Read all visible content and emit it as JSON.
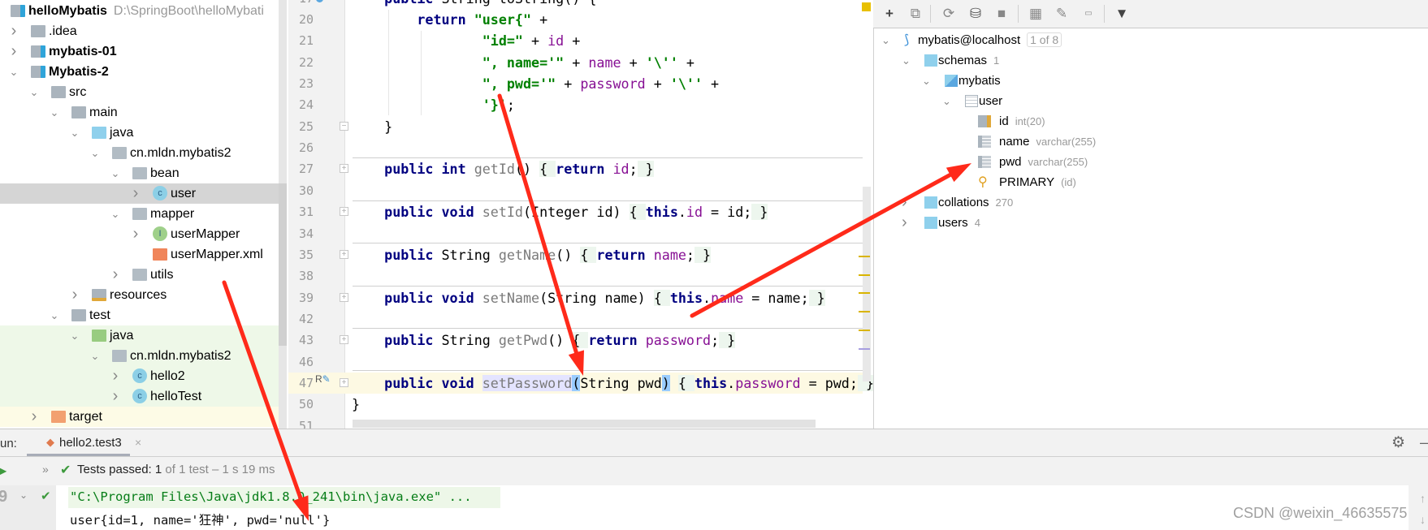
{
  "project_tree": {
    "rows": [
      {
        "label": "helloMybatis",
        "hint": "D:\\SpringBoot\\helloMybati",
        "level": -1,
        "chevron": "none",
        "icon": "module-folder",
        "bold": true
      },
      {
        "label": ".idea",
        "level": 0,
        "chevron": "right",
        "icon": "folder"
      },
      {
        "label": "mybatis-01",
        "level": 0,
        "chevron": "right",
        "icon": "module-folder",
        "bold": true
      },
      {
        "label": "Mybatis-2",
        "level": 0,
        "chevron": "down",
        "icon": "module-folder",
        "bold": true
      },
      {
        "label": "src",
        "level": 1,
        "chevron": "down",
        "icon": "folder"
      },
      {
        "label": "main",
        "level": 2,
        "chevron": "down",
        "icon": "folder"
      },
      {
        "label": "java",
        "level": 3,
        "chevron": "down",
        "icon": "source-folder"
      },
      {
        "label": "cn.mldn.mybatis2",
        "level": 4,
        "chevron": "down",
        "icon": "package"
      },
      {
        "label": "bean",
        "level": 5,
        "chevron": "down",
        "icon": "package"
      },
      {
        "label": "user",
        "level": 6,
        "chevron": "right",
        "icon": "class",
        "selected": true
      },
      {
        "label": "mapper",
        "level": 5,
        "chevron": "down",
        "icon": "package"
      },
      {
        "label": "userMapper",
        "level": 6,
        "chevron": "right",
        "icon": "interface"
      },
      {
        "label": "userMapper.xml",
        "level": 6,
        "chevron": "none",
        "icon": "xml-file"
      },
      {
        "label": "utils",
        "level": 5,
        "chevron": "right",
        "icon": "package"
      },
      {
        "label": "resources",
        "level": 3,
        "chevron": "right",
        "icon": "resources-folder"
      },
      {
        "label": "test",
        "level": 2,
        "chevron": "down",
        "icon": "folder"
      },
      {
        "label": "java",
        "level": 3,
        "chevron": "down",
        "icon": "test-source-folder",
        "tint": "green"
      },
      {
        "label": "cn.mldn.mybatis2",
        "level": 4,
        "chevron": "down",
        "icon": "package",
        "tint": "green"
      },
      {
        "label": "hello2",
        "level": 5,
        "chevron": "right",
        "icon": "test-class",
        "tint": "green"
      },
      {
        "label": "helloTest",
        "level": 5,
        "chevron": "right",
        "icon": "test-class",
        "tint": "green"
      },
      {
        "label": "target",
        "level": 1,
        "chevron": "right",
        "icon": "excluded-folder",
        "tint": "yellow"
      }
    ]
  },
  "editor": {
    "lines": [
      {
        "num": "17",
        "tokens": [
          [
            "kw",
            "    public "
          ],
          [
            "",
            "String toString() {"
          ]
        ]
      },
      {
        "num": "20",
        "tokens": [
          [
            "kw",
            "        return "
          ],
          [
            "str",
            "\"user{\""
          ],
          [
            "",
            " +"
          ]
        ]
      },
      {
        "num": "21",
        "tokens": [
          [
            "str",
            "                \"id=\""
          ],
          [
            "",
            " + "
          ],
          [
            "fld",
            "id"
          ],
          [
            "",
            " +"
          ]
        ]
      },
      {
        "num": "22",
        "tokens": [
          [
            "str",
            "                \", name='\""
          ],
          [
            "",
            " + "
          ],
          [
            "fld",
            "name"
          ],
          [
            "",
            " + "
          ],
          [
            "str",
            "'\\''"
          ],
          [
            "",
            " +"
          ]
        ]
      },
      {
        "num": "23",
        "tokens": [
          [
            "str",
            "                \", pwd='\""
          ],
          [
            "",
            " + "
          ],
          [
            "fld",
            "password"
          ],
          [
            "",
            " + "
          ],
          [
            "str",
            "'\\''"
          ],
          [
            "",
            " +"
          ]
        ]
      },
      {
        "num": "24",
        "tokens": [
          [
            "str",
            "                '}'"
          ],
          [
            "",
            ";"
          ]
        ]
      },
      {
        "num": "25",
        "tokens": [
          [
            "",
            "    }"
          ]
        ]
      },
      {
        "num": "26",
        "tokens": []
      },
      {
        "num": "27",
        "tokens": [
          [
            "kw",
            "    public int "
          ],
          [
            "meth",
            "getId"
          ],
          [
            "",
            "()"
          ],
          [
            "",
            " "
          ],
          [
            "fb",
            "{ "
          ],
          [
            "kw",
            "return "
          ],
          [
            "fld",
            "id"
          ],
          [
            "",
            ";"
          ],
          [
            "fb",
            " }"
          ]
        ]
      },
      {
        "num": "30",
        "tokens": []
      },
      {
        "num": "31",
        "tokens": [
          [
            "kw",
            "    public void "
          ],
          [
            "meth",
            "setId"
          ],
          [
            "",
            "(Integer id) "
          ],
          [
            "fb",
            "{ "
          ],
          [
            "kw",
            "this"
          ],
          [
            "",
            "."
          ],
          [
            "fld",
            "id"
          ],
          [
            "",
            " = id;"
          ],
          [
            "fb",
            " }"
          ]
        ]
      },
      {
        "num": "34",
        "tokens": []
      },
      {
        "num": "35",
        "tokens": [
          [
            "kw",
            "    public "
          ],
          [
            "",
            "String "
          ],
          [
            "meth",
            "getName"
          ],
          [
            "",
            "() "
          ],
          [
            "fb",
            "{ "
          ],
          [
            "kw",
            "return "
          ],
          [
            "fld",
            "name"
          ],
          [
            "",
            ";"
          ],
          [
            "fb",
            " }"
          ]
        ]
      },
      {
        "num": "38",
        "tokens": []
      },
      {
        "num": "39",
        "tokens": [
          [
            "kw",
            "    public void "
          ],
          [
            "meth",
            "setName"
          ],
          [
            "",
            "(String name) "
          ],
          [
            "fb",
            "{ "
          ],
          [
            "kw",
            "this"
          ],
          [
            "",
            "."
          ],
          [
            "fld",
            "name"
          ],
          [
            "",
            " = name;"
          ],
          [
            "fb",
            " }"
          ]
        ]
      },
      {
        "num": "42",
        "tokens": []
      },
      {
        "num": "43",
        "tokens": [
          [
            "kw",
            "    public "
          ],
          [
            "",
            "String "
          ],
          [
            "meth",
            "getPwd"
          ],
          [
            "",
            "() "
          ],
          [
            "fb",
            "{ "
          ],
          [
            "kw",
            "return "
          ],
          [
            "fld",
            "password"
          ],
          [
            "",
            ";"
          ],
          [
            "fb",
            " }"
          ]
        ]
      },
      {
        "num": "46",
        "tokens": []
      },
      {
        "num": "47",
        "tokens": [
          [
            "kw",
            "    public void "
          ],
          [
            "meth hl",
            "setPassword"
          ],
          [
            "par",
            "("
          ],
          [
            "",
            "String pwd"
          ],
          [
            "par",
            ")"
          ],
          [
            "",
            " "
          ],
          [
            "fb",
            "{ "
          ],
          [
            "kw",
            "this"
          ],
          [
            "",
            "."
          ],
          [
            "fld",
            "password"
          ],
          [
            "",
            " = pwd;"
          ],
          [
            "fb",
            " }"
          ]
        ]
      },
      {
        "num": "50",
        "tokens": [
          [
            "",
            "}"
          ]
        ]
      },
      {
        "num": "51",
        "tokens": []
      }
    ],
    "gutter_marker_47": "R"
  },
  "database": {
    "toolbar": [
      "add-icon",
      "duplicate-icon",
      "refresh-icon",
      "properties-icon",
      "stop-icon",
      "table-icon",
      "edit-icon",
      "sql-console-icon",
      "filter-icon"
    ],
    "rows": [
      {
        "label": "mybatis@localhost",
        "badge": "1 of 8",
        "level": 0,
        "chevron": "down",
        "icon": "mysql-datasource"
      },
      {
        "label": "schemas",
        "hint": "1",
        "level": 1,
        "chevron": "down",
        "icon": "folder"
      },
      {
        "label": "mybatis",
        "level": 2,
        "chevron": "down",
        "icon": "schema"
      },
      {
        "label": "user",
        "level": 3,
        "chevron": "down",
        "icon": "table"
      },
      {
        "label": "id",
        "hint": "int(20)",
        "level": 4,
        "chevron": "none",
        "icon": "primary-key-column"
      },
      {
        "label": "name",
        "hint": "varchar(255)",
        "level": 4,
        "chevron": "none",
        "icon": "column"
      },
      {
        "label": "pwd",
        "hint": "varchar(255)",
        "level": 4,
        "chevron": "none",
        "icon": "column"
      },
      {
        "label": "PRIMARY",
        "hint": "(id)",
        "level": 4,
        "chevron": "none",
        "icon": "key"
      },
      {
        "label": "collations",
        "hint": "270",
        "level": 1,
        "chevron": "right",
        "icon": "folder"
      },
      {
        "label": "users",
        "hint": "4",
        "level": 1,
        "chevron": "right",
        "icon": "folder"
      }
    ]
  },
  "run_panel": {
    "label": "un:",
    "tab": "hello2.test3",
    "status_prefix": "Tests passed:",
    "status_count": "1",
    "status_rest": "of 1 test – 1 s 19 ms",
    "gutter_number": "9",
    "console": [
      "\"C:\\Program Files\\Java\\jdk1.8.0_241\\bin\\java.exe\" ...",
      "user{id=1, name='狂神', pwd='null'}"
    ]
  },
  "watermark": "CSDN @weixin_46635575",
  "colors": {
    "arrow": "#ff2a1a",
    "keyword": "#000080",
    "string": "#008000",
    "field": "#871094",
    "selection": "#d5d5d5"
  }
}
